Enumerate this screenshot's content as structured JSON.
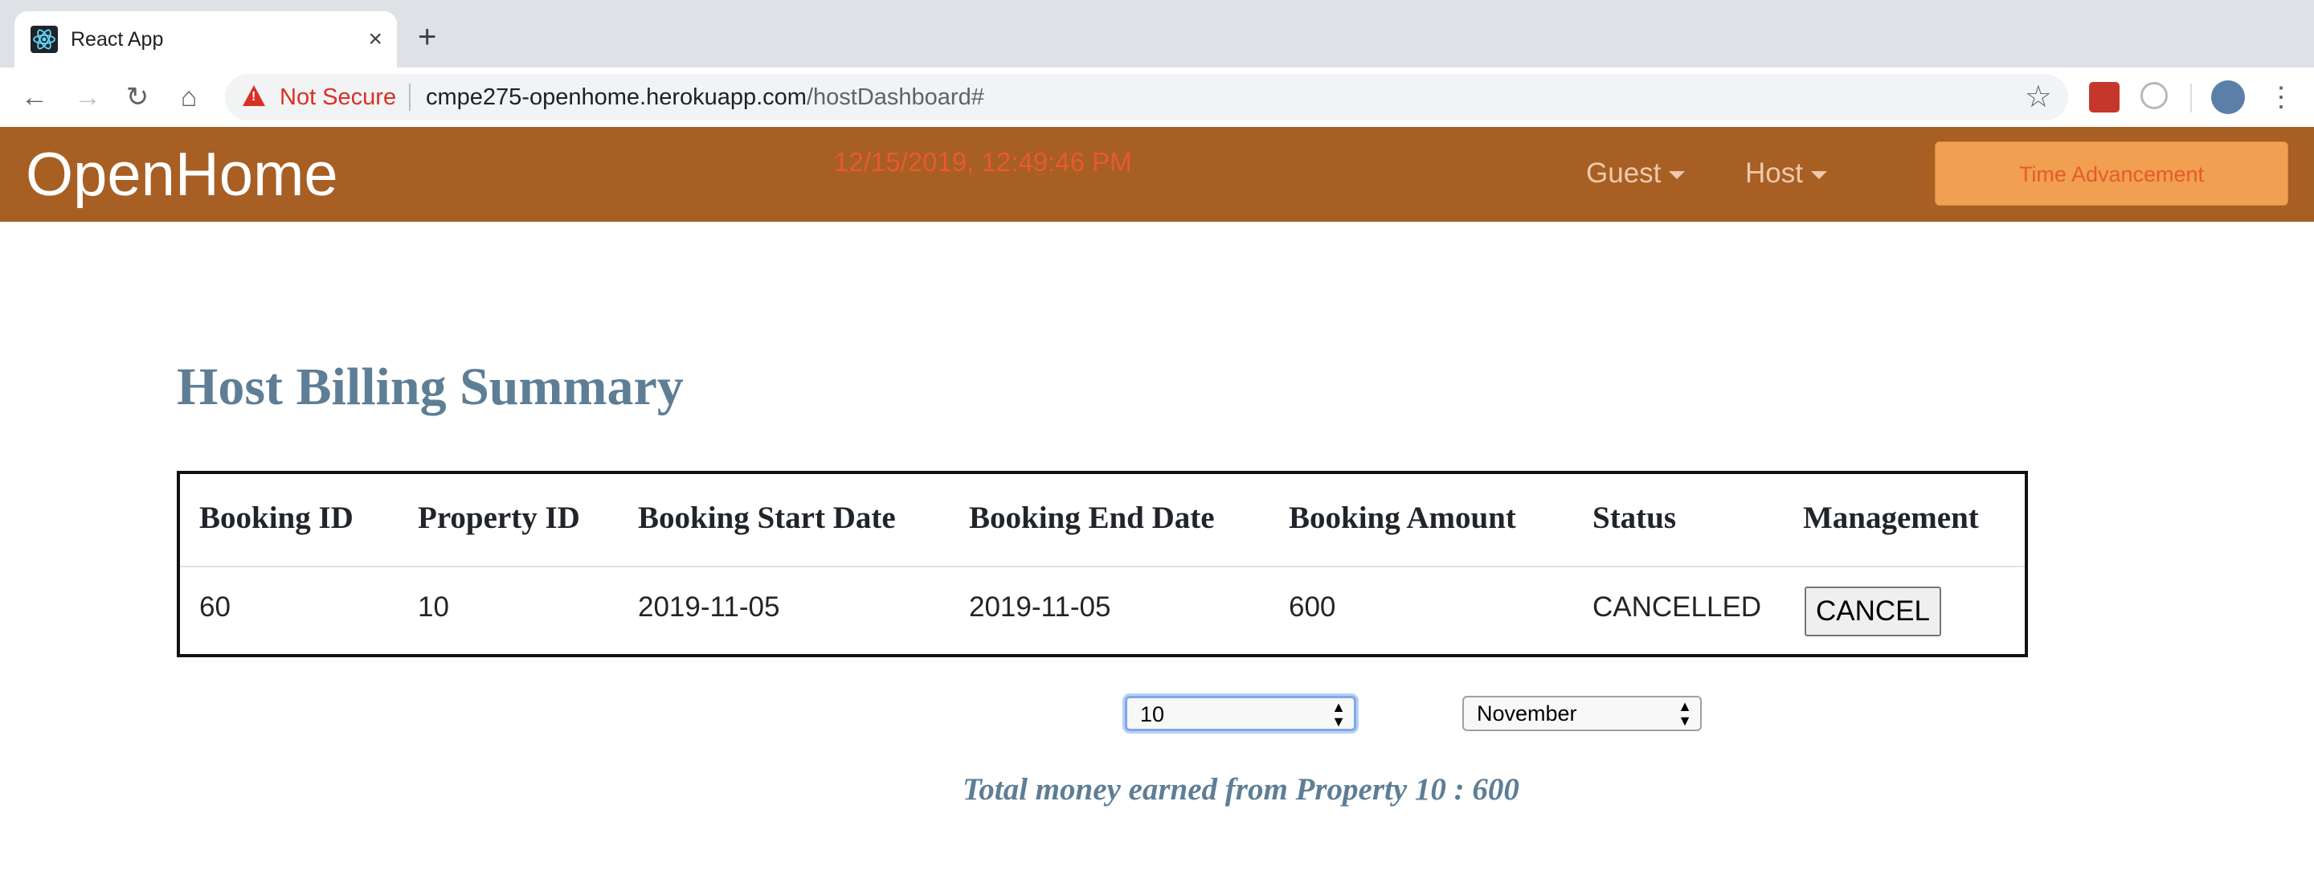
{
  "browser": {
    "tab_title": "React App",
    "security_label": "Not Secure",
    "url_host": "cmpe275-openhome.herokuapp.com",
    "url_path": "/hostDashboard#"
  },
  "navbar": {
    "brand": "OpenHome",
    "clock": "12/15/2019, 12:49:46 PM",
    "guest_menu": "Guest",
    "host_menu": "Host",
    "time_button": "Time Advancement",
    "colors": {
      "bar": "#a85f23",
      "clock": "#e65a2e",
      "button": "#f0a050"
    }
  },
  "page": {
    "title": "Host Billing Summary"
  },
  "table": {
    "headers": [
      "Booking ID",
      "Property ID",
      "Booking Start Date",
      "Booking End Date",
      "Booking Amount",
      "Status",
      "Management"
    ],
    "rows": [
      {
        "booking_id": "60",
        "property_id": "10",
        "start": "2019-11-05",
        "end": "2019-11-05",
        "amount": "600",
        "status": "CANCELLED",
        "action": "CANCEL"
      }
    ]
  },
  "filters": {
    "property_value": "10",
    "month_value": "November"
  },
  "summary": {
    "total_text": "Total money earned from Property 10 : 600"
  }
}
